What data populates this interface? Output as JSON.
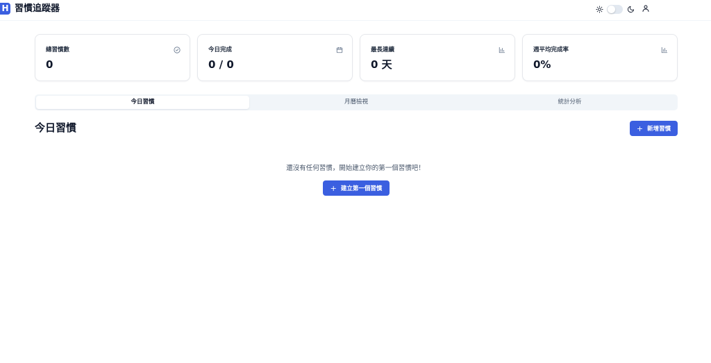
{
  "app": {
    "logo_letter": "H",
    "title": "習慣追蹤器"
  },
  "header": {
    "theme_toggle_state": "light",
    "icons": [
      "sun-icon",
      "moon-icon",
      "user-icon"
    ]
  },
  "stats": [
    {
      "label": "總習慣數",
      "value": "0",
      "icon": "check-circle-icon"
    },
    {
      "label": "今日完成",
      "value": "0 / 0",
      "icon": "calendar-icon"
    },
    {
      "label": "最長連續",
      "value": "0 天",
      "icon": "bar-chart-icon"
    },
    {
      "label": "週平均完成率",
      "value": "0%",
      "icon": "bar-chart-icon"
    }
  ],
  "tabs": [
    {
      "label": "今日習慣",
      "active": true
    },
    {
      "label": "月曆檢視",
      "active": false
    },
    {
      "label": "統計分析",
      "active": false
    }
  ],
  "section": {
    "title": "今日習慣",
    "add_button_label": "新增習慣"
  },
  "empty_state": {
    "message": "還沒有任何習慣，開始建立你的第一個習慣吧！",
    "button_label": "建立第一個習慣"
  },
  "colors": {
    "primary": "#3b5fe0",
    "tab_background": "#f1f5f9",
    "card_border": "#e5e7eb",
    "muted_text": "#475569"
  }
}
